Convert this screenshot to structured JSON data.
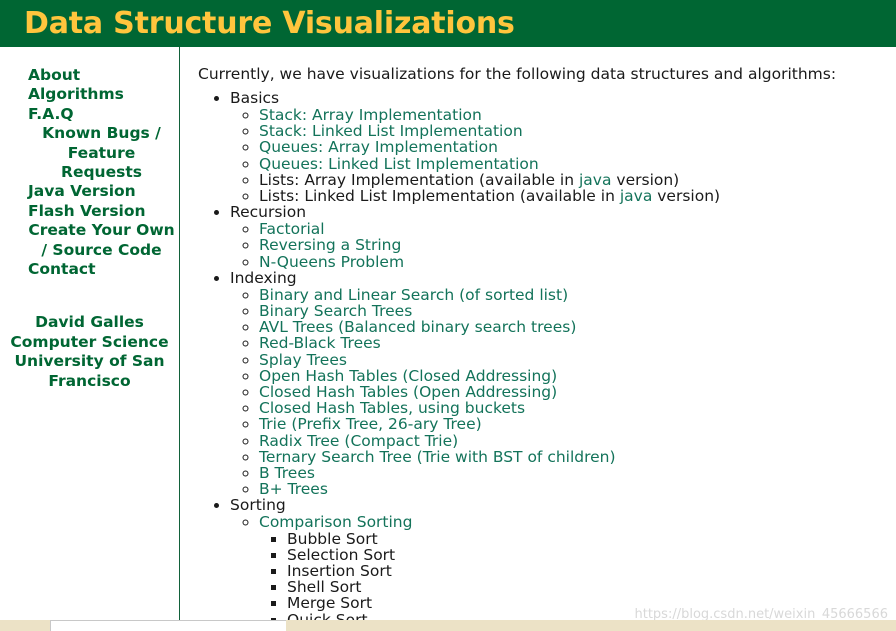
{
  "header": {
    "title": "Data Structure Visualizations"
  },
  "sidebar": {
    "links": [
      "About",
      "Algorithms",
      "F.A.Q",
      "Known Bugs / Feature Requests",
      "Java Version",
      "Flash Version",
      "Create Your Own / Source Code",
      "Contact"
    ],
    "author": {
      "name": "David Galles",
      "department": "Computer Science",
      "university": "University of San Francisco"
    }
  },
  "main": {
    "intro": "Currently, we have visualizations for the following data structures and algorithms:",
    "sections": [
      {
        "title": "Basics",
        "items": [
          {
            "text": "Stack: Array Implementation",
            "link": true
          },
          {
            "text": "Stack: Linked List Implementation",
            "link": true
          },
          {
            "text": "Queues: Array Implementation",
            "link": true
          },
          {
            "text": "Queues: Linked List Implementation",
            "link": true
          },
          {
            "text": "Lists: Array Implementation (available in java version)",
            "link": false,
            "prefix": "Lists: Array Implementation (available in ",
            "inline_link": "java",
            "suffix": " version)"
          },
          {
            "text": "Lists: Linked List Implementation (available in java version)",
            "link": false,
            "prefix": "Lists: Linked List Implementation (available in ",
            "inline_link": "java",
            "suffix": " version)"
          }
        ]
      },
      {
        "title": "Recursion",
        "items": [
          {
            "text": "Factorial",
            "link": true
          },
          {
            "text": "Reversing a String",
            "link": true
          },
          {
            "text": "N-Queens Problem",
            "link": true
          }
        ]
      },
      {
        "title": "Indexing",
        "items": [
          {
            "text": "Binary and Linear Search (of sorted list)",
            "link": true
          },
          {
            "text": "Binary Search Trees",
            "link": true
          },
          {
            "text": "AVL Trees (Balanced binary search trees)",
            "link": true
          },
          {
            "text": "Red-Black Trees",
            "link": true
          },
          {
            "text": "Splay Trees",
            "link": true
          },
          {
            "text": "Open Hash Tables (Closed Addressing)",
            "link": true
          },
          {
            "text": "Closed Hash Tables (Open Addressing)",
            "link": true
          },
          {
            "text": "Closed Hash Tables, using buckets",
            "link": true
          },
          {
            "text": "Trie (Prefix Tree, 26-ary Tree)",
            "link": true
          },
          {
            "text": "Radix Tree (Compact Trie)",
            "link": true
          },
          {
            "text": "Ternary Search Tree (Trie with BST of children)",
            "link": true
          },
          {
            "text": "B Trees",
            "link": true
          },
          {
            "text": "B+ Trees",
            "link": true
          }
        ]
      },
      {
        "title": "Sorting",
        "items": [
          {
            "text": "Comparison Sorting",
            "link": true,
            "children": [
              {
                "text": "Bubble Sort",
                "link": false
              },
              {
                "text": "Selection Sort",
                "link": false
              },
              {
                "text": "Insertion Sort",
                "link": false
              },
              {
                "text": "Shell Sort",
                "link": false
              },
              {
                "text": "Merge Sort",
                "link": false
              },
              {
                "text": "Quick Sort",
                "link": false
              }
            ]
          }
        ]
      }
    ]
  },
  "watermark": "https://blog.csdn.net/weixin_45666566",
  "colors": {
    "banner_background": "#006633",
    "banner_title": "#ffc53d",
    "sidebar_link": "#006633",
    "content_link": "#13735a",
    "body_text": "#1a1a1a",
    "page_background": "#ece2c6"
  }
}
